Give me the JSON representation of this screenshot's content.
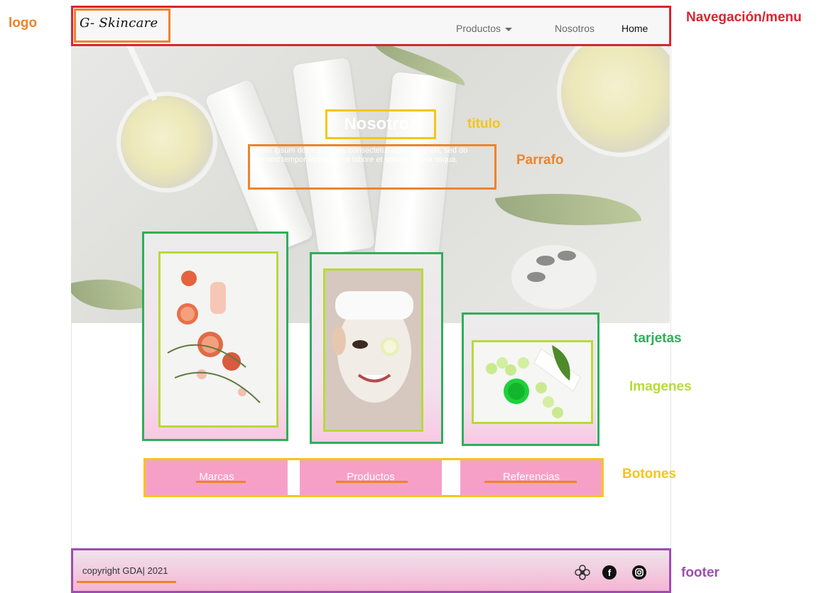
{
  "navbar": {
    "logo": "G- Skincare",
    "items": [
      {
        "label": "Productos",
        "dropdown": true
      },
      {
        "label": "Nosotros"
      },
      {
        "label": "Home"
      }
    ]
  },
  "hero": {
    "title": "Nosotros",
    "paragraph": "Lorem ipsum dolor sit amet, consectetur adipisicing elit, sed do eiusmod tempor incididunt ut labore et dolore magna aliqua."
  },
  "buttons": [
    {
      "label": "Marcas"
    },
    {
      "label": "Productos"
    },
    {
      "label": "Referencias"
    }
  ],
  "footer": {
    "copyright": "copyright GDA| 2021",
    "icons": [
      "flower-icon",
      "facebook-icon",
      "instagram-icon"
    ]
  },
  "annotations": {
    "logo": "logo",
    "nav": "Navegación/menu",
    "title": "titulo",
    "paragraph": "Parrafo",
    "cards": "tarjetas",
    "images": "Imagenes",
    "buttons": "Botones",
    "footer": "footer"
  },
  "colors": {
    "nav_box": "#d8262e",
    "logo_box": "#f0832a",
    "title_box": "#f5c518",
    "card_box": "#2fae5a",
    "image_box": "#b6db38",
    "footer_box": "#9c4db3",
    "button_pink": "#f7a0c7"
  }
}
